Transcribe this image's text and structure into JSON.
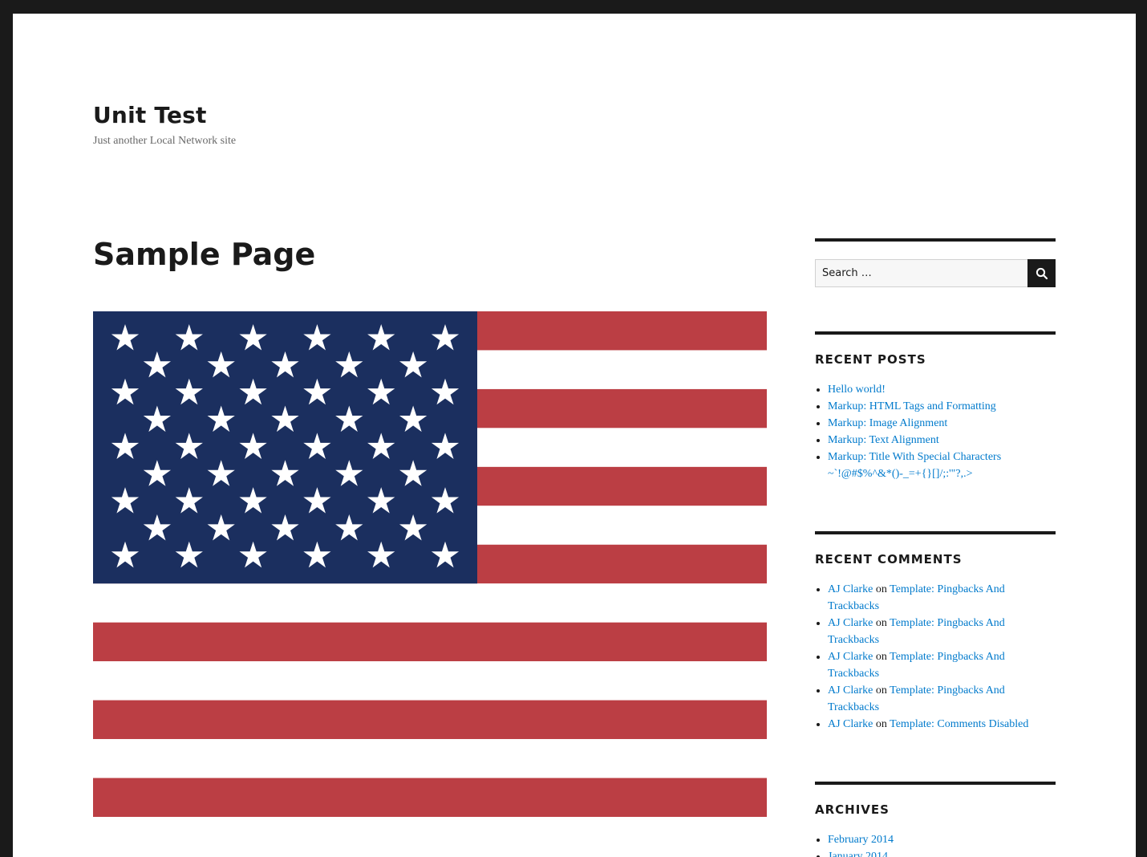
{
  "site": {
    "title": "Unit Test",
    "description": "Just another Local Network site"
  },
  "page": {
    "title": "Sample Page"
  },
  "flag": {
    "red": "#bb3e44",
    "blue": "#1b2f5f",
    "white": "#ffffff"
  },
  "sidebar": {
    "search": {
      "placeholder": "Search …",
      "icon": "search-icon"
    },
    "recent_posts": {
      "title": "RECENT POSTS",
      "items": [
        "Hello world!",
        "Markup: HTML Tags and Formatting",
        "Markup: Image Alignment",
        "Markup: Text Alignment",
        "Markup: Title With Special Characters ~`!@#$%^&*()-_=+{}[]/;:'\"?,.>"
      ]
    },
    "recent_comments": {
      "title": "RECENT COMMENTS",
      "items": [
        {
          "author": "AJ Clarke",
          "sep": "on",
          "post": "Template: Pingbacks And Trackbacks"
        },
        {
          "author": "AJ Clarke",
          "sep": "on",
          "post": "Template: Pingbacks And Trackbacks"
        },
        {
          "author": "AJ Clarke",
          "sep": "on",
          "post": "Template: Pingbacks And Trackbacks"
        },
        {
          "author": "AJ Clarke",
          "sep": "on",
          "post": "Template: Pingbacks And Trackbacks"
        },
        {
          "author": "AJ Clarke",
          "sep": "on",
          "post": "Template: Comments Disabled"
        }
      ]
    },
    "archives": {
      "title": "ARCHIVES",
      "items": [
        "February 2014",
        "January 2014"
      ]
    }
  }
}
